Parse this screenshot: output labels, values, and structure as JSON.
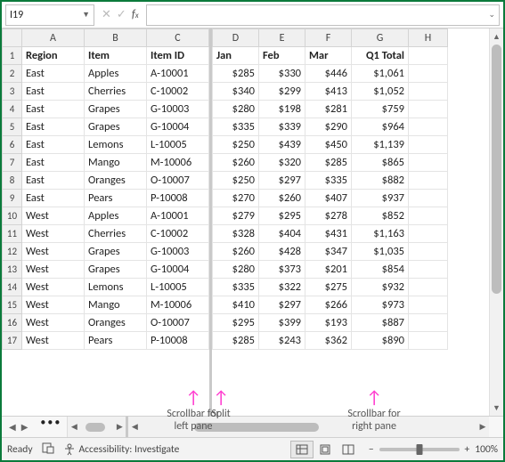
{
  "namebox": {
    "ref": "I19"
  },
  "columns_left": [
    "A",
    "B",
    "C"
  ],
  "columns_right": [
    "D",
    "E",
    "F",
    "G",
    "H"
  ],
  "header_row": {
    "region": "Region",
    "item": "Item",
    "item_id": "Item ID",
    "jan": "Jan",
    "feb": "Feb",
    "mar": "Mar",
    "q1": "Q1 Total"
  },
  "rows": [
    {
      "n": 2,
      "region": "East",
      "item": "Apples",
      "id": "A-10001",
      "jan": "$285",
      "feb": "$330",
      "mar": "$446",
      "q1": "$1,061"
    },
    {
      "n": 3,
      "region": "East",
      "item": "Cherries",
      "id": "C-10002",
      "jan": "$340",
      "feb": "$299",
      "mar": "$413",
      "q1": "$1,052"
    },
    {
      "n": 4,
      "region": "East",
      "item": "Grapes",
      "id": "G-10003",
      "jan": "$280",
      "feb": "$198",
      "mar": "$281",
      "q1": "$759"
    },
    {
      "n": 5,
      "region": "East",
      "item": "Grapes",
      "id": "G-10004",
      "jan": "$335",
      "feb": "$339",
      "mar": "$290",
      "q1": "$964"
    },
    {
      "n": 6,
      "region": "East",
      "item": "Lemons",
      "id": "L-10005",
      "jan": "$250",
      "feb": "$439",
      "mar": "$450",
      "q1": "$1,139"
    },
    {
      "n": 7,
      "region": "East",
      "item": "Mango",
      "id": "M-10006",
      "jan": "$260",
      "feb": "$320",
      "mar": "$285",
      "q1": "$865"
    },
    {
      "n": 8,
      "region": "East",
      "item": "Oranges",
      "id": "O-10007",
      "jan": "$250",
      "feb": "$297",
      "mar": "$335",
      "q1": "$882"
    },
    {
      "n": 9,
      "region": "East",
      "item": "Pears",
      "id": "P-10008",
      "jan": "$270",
      "feb": "$260",
      "mar": "$407",
      "q1": "$937"
    },
    {
      "n": 10,
      "region": "West",
      "item": "Apples",
      "id": "A-10001",
      "jan": "$279",
      "feb": "$295",
      "mar": "$278",
      "q1": "$852"
    },
    {
      "n": 11,
      "region": "West",
      "item": "Cherries",
      "id": "C-10002",
      "jan": "$328",
      "feb": "$404",
      "mar": "$431",
      "q1": "$1,163"
    },
    {
      "n": 12,
      "region": "West",
      "item": "Grapes",
      "id": "G-10003",
      "jan": "$260",
      "feb": "$428",
      "mar": "$347",
      "q1": "$1,035"
    },
    {
      "n": 13,
      "region": "West",
      "item": "Grapes",
      "id": "G-10004",
      "jan": "$280",
      "feb": "$373",
      "mar": "$201",
      "q1": "$854"
    },
    {
      "n": 14,
      "region": "West",
      "item": "Lemons",
      "id": "L-10005",
      "jan": "$335",
      "feb": "$322",
      "mar": "$275",
      "q1": "$932"
    },
    {
      "n": 15,
      "region": "West",
      "item": "Mango",
      "id": "M-10006",
      "jan": "$410",
      "feb": "$297",
      "mar": "$266",
      "q1": "$973"
    },
    {
      "n": 16,
      "region": "West",
      "item": "Oranges",
      "id": "O-10007",
      "jan": "$295",
      "feb": "$399",
      "mar": "$193",
      "q1": "$887"
    },
    {
      "n": 17,
      "region": "West",
      "item": "Pears",
      "id": "P-10008",
      "jan": "$285",
      "feb": "$243",
      "mar": "$362",
      "q1": "$890"
    }
  ],
  "status": {
    "ready": "Ready",
    "accessibility": "Accessibility: Investigate",
    "zoom": "100%"
  },
  "annotations": {
    "left_scroll": "Scrollbar for\nleft pane",
    "split": "Split",
    "right_scroll": "Scrollbar for\nright pane"
  }
}
